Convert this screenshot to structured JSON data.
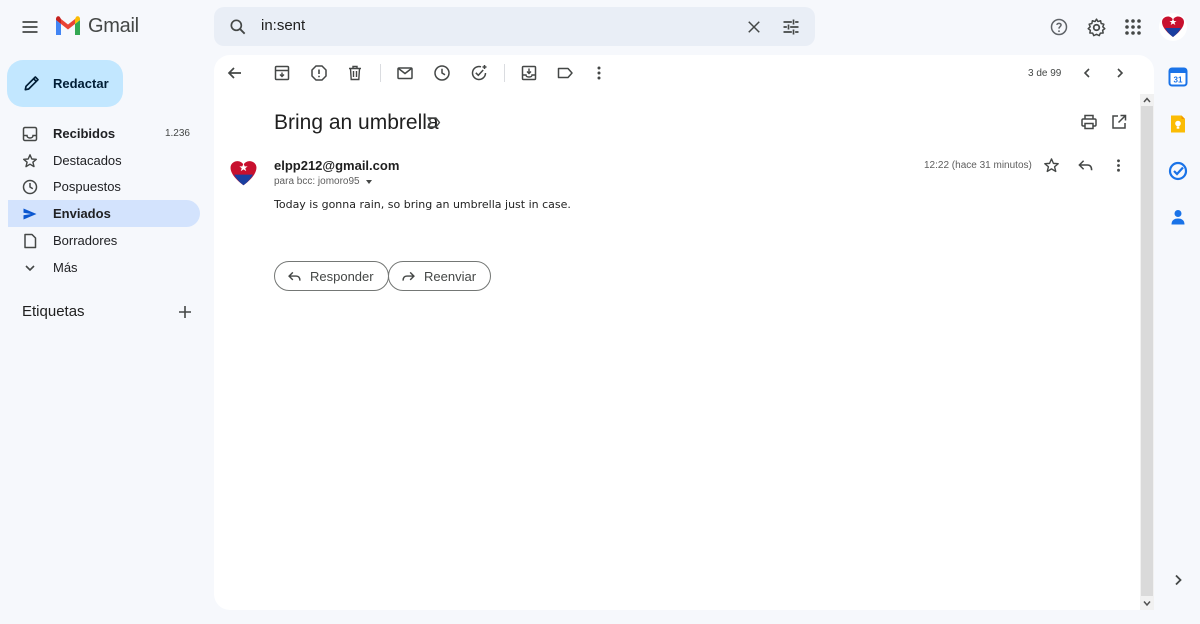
{
  "app": {
    "name": "Gmail"
  },
  "search": {
    "value": "in:sent",
    "icon": "search-icon"
  },
  "sidebar": {
    "compose_label": "Redactar",
    "items": [
      {
        "label": "Recibidos",
        "count": "1.236",
        "icon": "inbox-icon",
        "bold": true
      },
      {
        "label": "Destacados",
        "icon": "star-icon"
      },
      {
        "label": "Pospuestos",
        "icon": "clock-icon"
      },
      {
        "label": "Enviados",
        "icon": "send-icon",
        "active": true,
        "bold": true
      },
      {
        "label": "Borradores",
        "icon": "draft-icon"
      },
      {
        "label": "Más",
        "icon": "chevron-down-icon"
      }
    ],
    "labels_heading": "Etiquetas"
  },
  "toolbar": {
    "pager_text": "3 de 99"
  },
  "message": {
    "subject": "Bring an umbrella",
    "sender": "elpp212@gmail.com",
    "recipients": "para bcc: jomoro95",
    "time": "12:22 (hace 31 minutos)",
    "body": "Today is gonna rain, so bring an umbrella just in case."
  },
  "actions": {
    "reply_label": "Responder",
    "forward_label": "Reenviar"
  },
  "colors": {
    "accent": "#0b57d0",
    "compose_bg": "#c2e7ff",
    "active_nav_bg": "#d3e3fd",
    "background": "#f6f8fc",
    "gmail_red": "#ea4335"
  }
}
